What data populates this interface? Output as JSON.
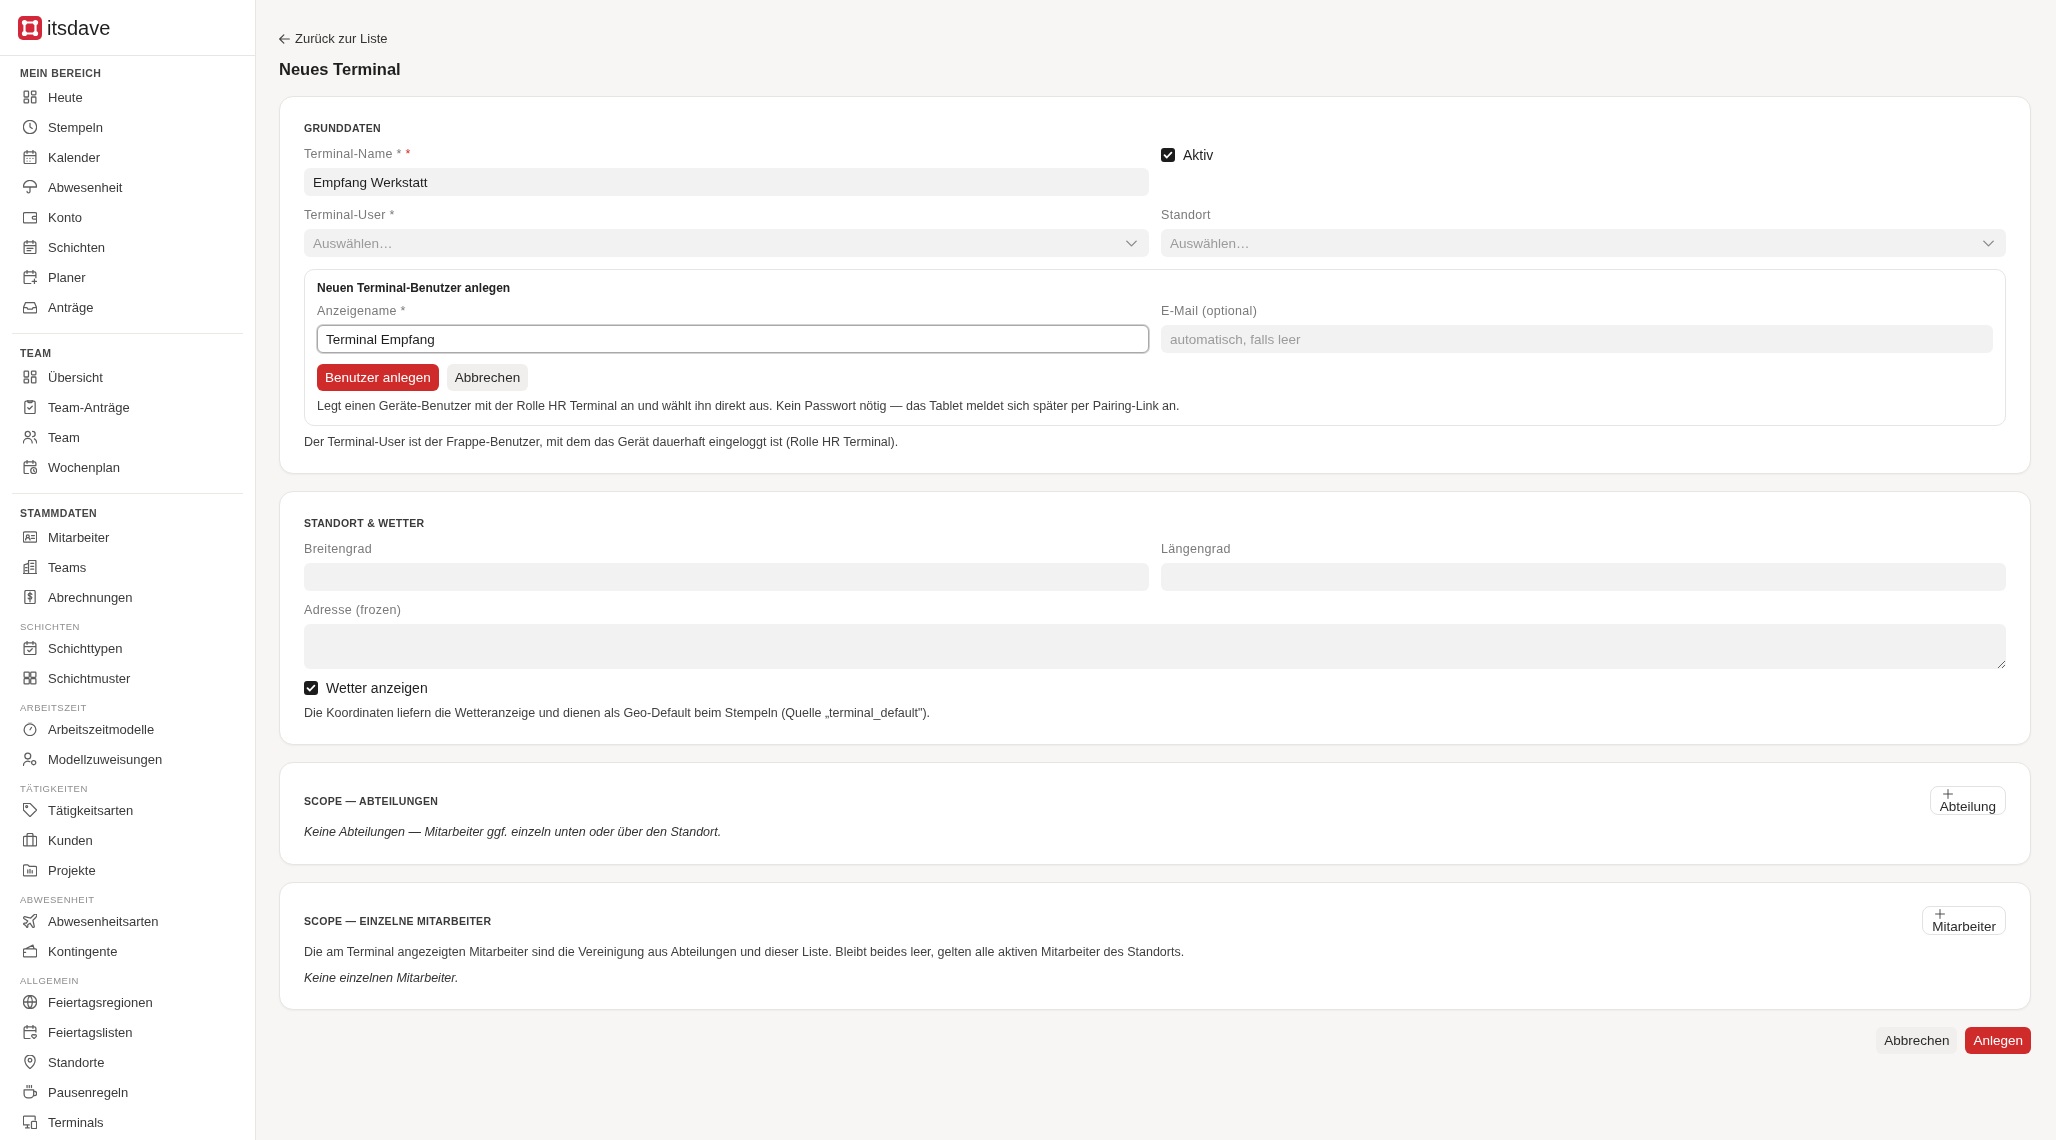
{
  "sidebar": {
    "logo_text": "itsdave",
    "sections": [
      {
        "title": "MEIN BEREICH",
        "items": [
          "Heute",
          "Stempeln",
          "Kalender",
          "Abwesenheit",
          "Konto",
          "Schichten",
          "Planer",
          "Anträge"
        ]
      },
      {
        "title": "TEAM",
        "items": [
          "Übersicht",
          "Team-Anträge",
          "Team",
          "Wochenplan"
        ]
      },
      {
        "title": "STAMMDATEN",
        "items": [
          "Mitarbeiter",
          "Teams",
          "Abrechnungen"
        ],
        "groups": [
          {
            "title": "SCHICHTEN",
            "items": [
              "Schichttypen",
              "Schichtmuster"
            ]
          },
          {
            "title": "ARBEITSZEIT",
            "items": [
              "Arbeitszeitmodelle",
              "Modellzuweisungen"
            ]
          },
          {
            "title": "TÄTIGKEITEN",
            "items": [
              "Tätigkeitsarten",
              "Kunden",
              "Projekte"
            ]
          },
          {
            "title": "ABWESENHEIT",
            "items": [
              "Abwesenheitsarten",
              "Kontingente"
            ]
          },
          {
            "title": "ALLGEMEIN",
            "items": [
              "Feiertagsregionen",
              "Feiertagslisten",
              "Standorte",
              "Pausenregeln",
              "Terminals"
            ]
          }
        ]
      }
    ]
  },
  "back_link": "Zurück zur Liste",
  "page_title": "Neues Terminal",
  "basic_data": {
    "title": "GRUNDDATEN",
    "terminal_name": {
      "label": "Terminal-Name *",
      "required_mark": "*",
      "value": "Empfang Werkstatt"
    },
    "active": {
      "label": "Aktiv",
      "checked": true
    },
    "terminal_user": {
      "label": "Terminal-User *",
      "placeholder": "Auswählen…"
    },
    "location": {
      "label": "Standort",
      "placeholder": "Auswählen…"
    },
    "new_user_panel": {
      "title": "Neuen Terminal-Benutzer anlegen",
      "display_name": {
        "label": "Anzeigename *",
        "value": "Terminal Empfang",
        "focused": true
      },
      "email": {
        "label": "E-Mail (optional)",
        "placeholder": "automatisch, falls leer"
      },
      "buttons": [
        {
          "label": "Benutzer anlegen",
          "kind": "primary"
        },
        {
          "label": "Abbrechen",
          "kind": "secondary"
        }
      ],
      "hint": "Legt einen Geräte-Benutzer mit der Rolle HR Terminal an und wählt ihn direkt aus. Kein Passwort nötig — das Tablet meldet sich später per Pairing-Link an."
    },
    "note": "Der Terminal-User ist der Frappe-Benutzer, mit dem das Gerät dauerhaft eingeloggt ist (Rolle HR Terminal)."
  },
  "location_weather": {
    "title": "STANDORT & WETTER",
    "latitude": {
      "label": "Breitengrad"
    },
    "longitude": {
      "label": "Längengrad"
    },
    "address": {
      "label": "Adresse (frozen)"
    },
    "show_weather": {
      "label": "Wetter anzeigen",
      "checked": true
    },
    "note": "Die Koordinaten liefern die Wetteranzeige und dienen als Geo-Default beim Stempeln (Quelle „terminal_default\")."
  },
  "scope_departments": {
    "title": "SCOPE — ABTEILUNGEN",
    "add_button": "Abteilung",
    "empty_text": "Keine Abteilungen — Mitarbeiter ggf. einzeln unten oder über den Standort."
  },
  "scope_employees": {
    "title": "SCOPE — EINZELNE MITARBEITER",
    "add_button": "Mitarbeiter",
    "description": "Die am Terminal angezeigten Mitarbeiter sind die Vereinigung aus Abteilungen und dieser Liste. Bleibt beides leer, gelten alle aktiven Mitarbeiter des Standorts.",
    "empty_text": "Keine einzelnen Mitarbeiter."
  },
  "footer_buttons": [
    {
      "label": "Abbrechen",
      "kind": "secondary"
    },
    {
      "label": "Anlegen",
      "kind": "primary"
    }
  ]
}
